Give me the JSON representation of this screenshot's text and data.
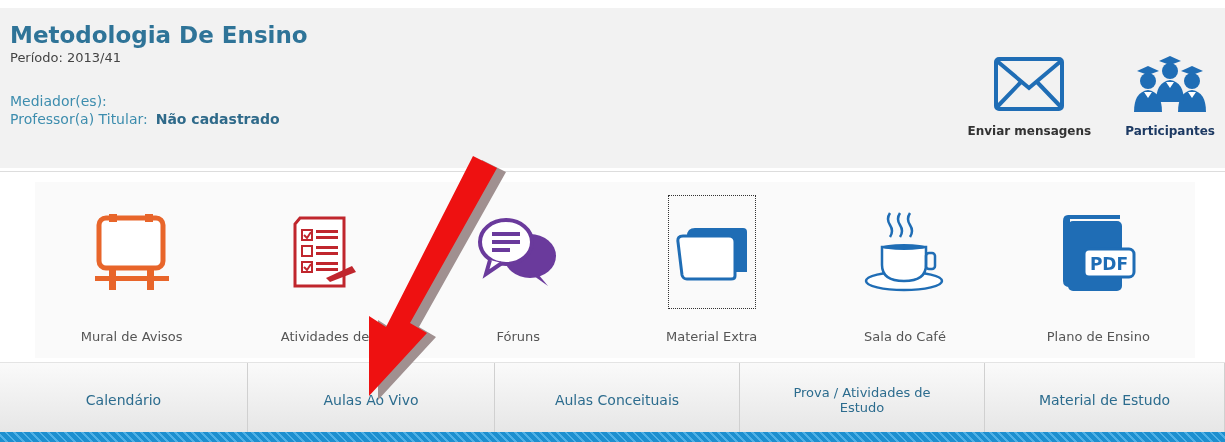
{
  "course": {
    "title": "Metodologia De Ensino",
    "period": "Período: 2013/41",
    "mediators_label": "Mediador(es):",
    "professor_label": "Professor(a) Titular:",
    "professor_value": "Não cadastrado"
  },
  "header_actions": [
    {
      "kind": "mail",
      "label": "Enviar mensagens"
    },
    {
      "kind": "people",
      "label": "Participantes"
    }
  ],
  "tools": [
    {
      "kind": "board",
      "label": "Mural de Avisos",
      "focused": false
    },
    {
      "kind": "checklist",
      "label": "Atividades de",
      "focused": false
    },
    {
      "kind": "chat",
      "label": "Fóruns",
      "focused": false
    },
    {
      "kind": "folder",
      "label": "Material Extra",
      "focused": true
    },
    {
      "kind": "coffee",
      "label": "Sala do Café",
      "focused": false
    },
    {
      "kind": "pdf",
      "label": "Plano de Ensino",
      "badge": "PDF",
      "focused": false
    }
  ],
  "tabs": [
    {
      "label": "Calendário"
    },
    {
      "label": "Aulas Ao Vivo"
    },
    {
      "label": "Aulas Conceituais"
    },
    {
      "label": "Prova / Atividades de Estudo"
    },
    {
      "label": "Material de Estudo"
    }
  ],
  "annotation": {
    "kind": "arrow"
  }
}
